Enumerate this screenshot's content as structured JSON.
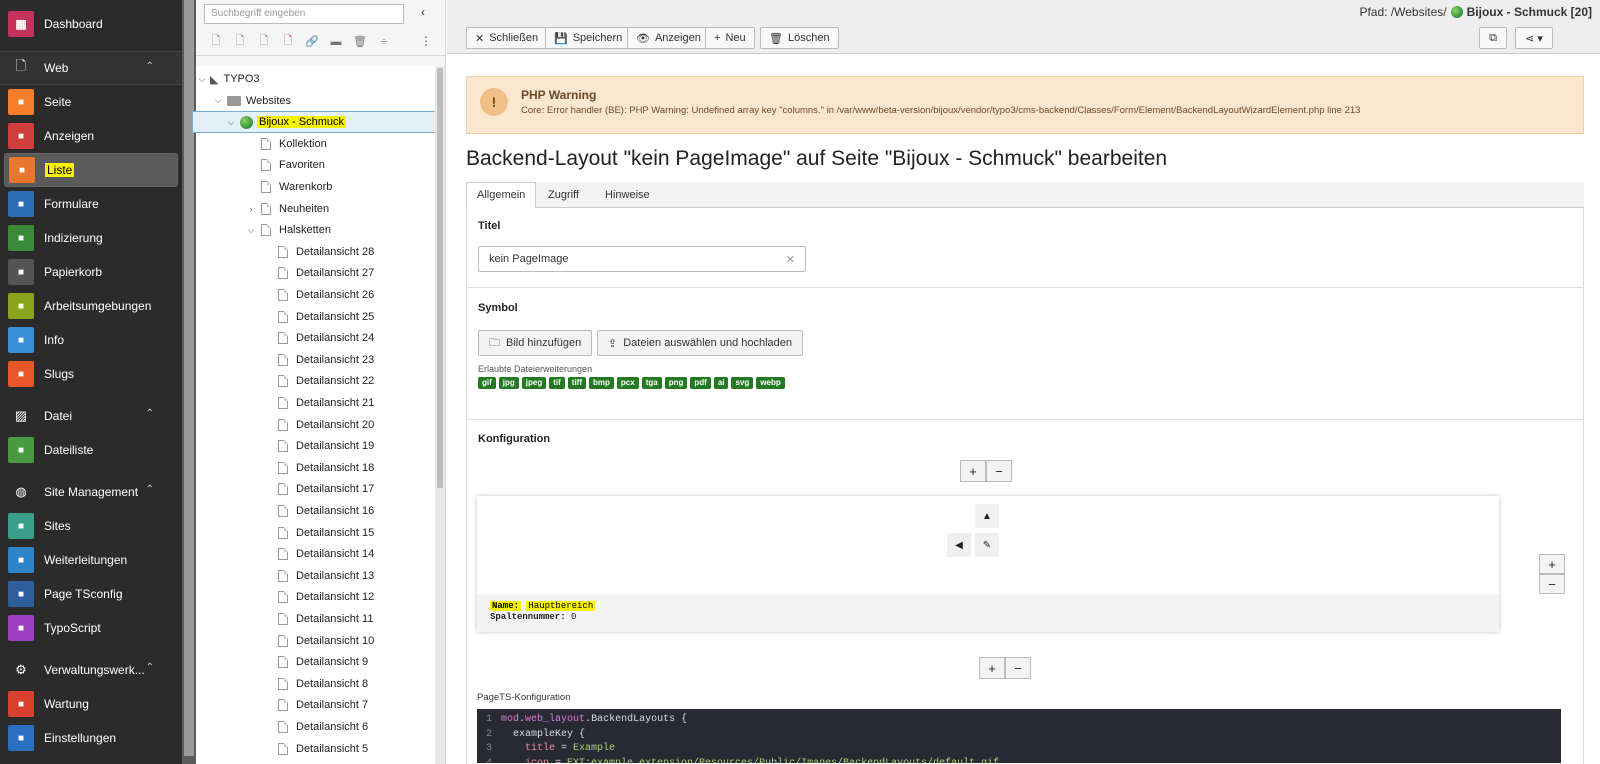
{
  "modules": {
    "dashboard": {
      "label": "Dashboard",
      "color": "#c5305c"
    },
    "web_group": "Web",
    "web_items": [
      {
        "label": "Seite",
        "color": "#f57d2c",
        "icon": "page-icon"
      },
      {
        "label": "Anzeigen",
        "color": "#d13c3c",
        "icon": "eye-icon"
      },
      {
        "label": "Liste",
        "color": "#e8762e",
        "icon": "list-icon"
      },
      {
        "label": "Formulare",
        "color": "#2b6fb5",
        "icon": "form-icon"
      },
      {
        "label": "Indizierung",
        "color": "#3b8a38",
        "icon": "chart-icon"
      },
      {
        "label": "Papierkorb",
        "color": "#555555",
        "icon": "trash-icon"
      },
      {
        "label": "Arbeitsumgebungen",
        "color": "#8aa51c",
        "icon": "workspace-icon"
      },
      {
        "label": "Info",
        "color": "#3b8fd6",
        "icon": "info-icon"
      },
      {
        "label": "Slugs",
        "color": "#e8572a",
        "icon": "slug-icon"
      }
    ],
    "file_group": "Datei",
    "file_items": [
      {
        "label": "Dateiliste",
        "color": "#4a9a42",
        "icon": "filelist-icon"
      }
    ],
    "site_group": "Site Management",
    "site_items": [
      {
        "label": "Sites",
        "color": "#3aa08c",
        "icon": "sites-icon"
      },
      {
        "label": "Weiterleitungen",
        "color": "#2f83c9",
        "icon": "redirect-icon"
      },
      {
        "label": "Page TSconfig",
        "color": "#2e5f9c",
        "icon": "tsconfig-icon"
      },
      {
        "label": "TypoScript",
        "color": "#9b3fbf",
        "icon": "typoscript-icon"
      }
    ],
    "admin_group": "Verwaltungswerk...",
    "admin_items": [
      {
        "label": "Wartung",
        "color": "#d6402c",
        "icon": "wrench-icon"
      },
      {
        "label": "Einstellungen",
        "color": "#2a6fc0",
        "icon": "settings-icon"
      }
    ]
  },
  "tree": {
    "search_placeholder": "Suchbegriff eingeben",
    "root": "TYPO3",
    "websites": "Websites",
    "site": "Bijoux - Schmuck",
    "pages": [
      "Kollektion",
      "Favoriten",
      "Warenkorb",
      "Neuheiten",
      "Halsketten"
    ],
    "details": [
      "Detailansicht 28",
      "Detailansicht 27",
      "Detailansicht 26",
      "Detailansicht 25",
      "Detailansicht 24",
      "Detailansicht 23",
      "Detailansicht 22",
      "Detailansicht 21",
      "Detailansicht 20",
      "Detailansicht 19",
      "Detailansicht 18",
      "Detailansicht 17",
      "Detailansicht 16",
      "Detailansicht 15",
      "Detailansicht 14",
      "Detailansicht 13",
      "Detailansicht 12",
      "Detailansicht 11",
      "Detailansicht 10",
      "Detailansicht 9",
      "Detailansicht 8",
      "Detailansicht 7",
      "Detailansicht 6",
      "Detailansicht 5"
    ]
  },
  "header": {
    "path_label": "Pfad:",
    "path": "/Websites/",
    "page": "Bijoux - Schmuck [20]",
    "buttons": {
      "close": "Schließen",
      "save": "Speichern",
      "view": "Anzeigen",
      "new": "Neu",
      "delete": "Löschen"
    }
  },
  "alert": {
    "icon": "!",
    "title": "PHP Warning",
    "message": "Core: Error handler (BE): PHP Warning: Undefined array key \"columns.\" in /var/www/beta-version/bijoux/vendor/typo3/cms-backend/Classes/Form/Element/BackendLayoutWizardElement.php line 213"
  },
  "form": {
    "heading": "Backend-Layout \"kein PageImage\" auf Seite \"Bijoux - Schmuck\" bearbeiten",
    "tabs": [
      "Allgemein",
      "Zugriff",
      "Hinweise"
    ],
    "title_label": "Titel",
    "title_value": "kein PageImage",
    "symbol_label": "Symbol",
    "add_image": "Bild hinzufügen",
    "upload": "Dateien auswählen und hochladen",
    "allowed_label": "Erlaubte Dateierweiterungen",
    "extensions": [
      "gif",
      "jpg",
      "jpeg",
      "tif",
      "tiff",
      "bmp",
      "pcx",
      "tga",
      "png",
      "pdf",
      "ai",
      "svg",
      "webp"
    ],
    "config_label": "Konfiguration",
    "plus": "+",
    "minus": "−",
    "cell_name_key": "Name:",
    "cell_name": "Hauptbereich",
    "cell_col_key": "Spaltennummer:",
    "cell_col": "0",
    "pagets_label": "PageTS-Konfiguration",
    "code": [
      {
        "n": "1",
        "parts": [
          [
            "kw",
            "mod"
          ],
          [
            "",
            "."
          ],
          [
            "kw",
            "web_layout"
          ],
          [
            "",
            "."
          ],
          [
            "",
            "BackendLayouts {"
          ]
        ]
      },
      {
        "n": "2",
        "parts": [
          [
            "",
            "  exampleKey {"
          ]
        ]
      },
      {
        "n": "3",
        "parts": [
          [
            "prop",
            "    title"
          ],
          [
            "",
            " = "
          ],
          [
            "str",
            "Example"
          ]
        ]
      },
      {
        "n": "4",
        "parts": [
          [
            "prop",
            "    icon"
          ],
          [
            "",
            " = "
          ],
          [
            "str",
            "EXT:example_extension/Resources/Public/Images/BackendLayouts/default.gif"
          ]
        ]
      }
    ]
  }
}
